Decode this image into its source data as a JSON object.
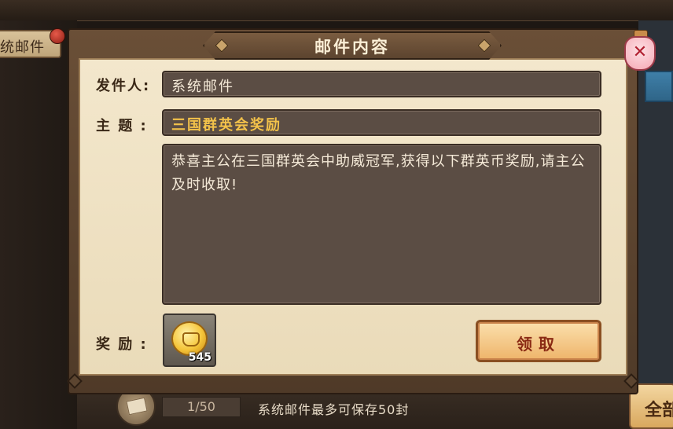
{
  "background": {
    "left_tab_label": "统邮件",
    "mail_count": "1/50",
    "footer_note": "系统邮件最多可保存50封",
    "right_button_label": "全部"
  },
  "dialog": {
    "title": "邮件内容",
    "close_icon": "close-x-icon",
    "sender_label": "发件人:",
    "sender_value": "系统邮件",
    "subject_label": "主 题 :",
    "subject_value": "三国群英会奖励",
    "body_text": "恭喜主公在三国群英会中助威冠军,获得以下群英币奖励,请主公及时收取!",
    "reward_label": "奖 励 :",
    "reward_icon": "gold-coin-icon",
    "reward_quantity": "545",
    "claim_button_label": "领取"
  },
  "colors": {
    "subject_highlight": "#f3c24a",
    "field_bg": "#5b4d44",
    "panel_bg": "#f3e7cc",
    "button_bg": "#eeb46a"
  }
}
